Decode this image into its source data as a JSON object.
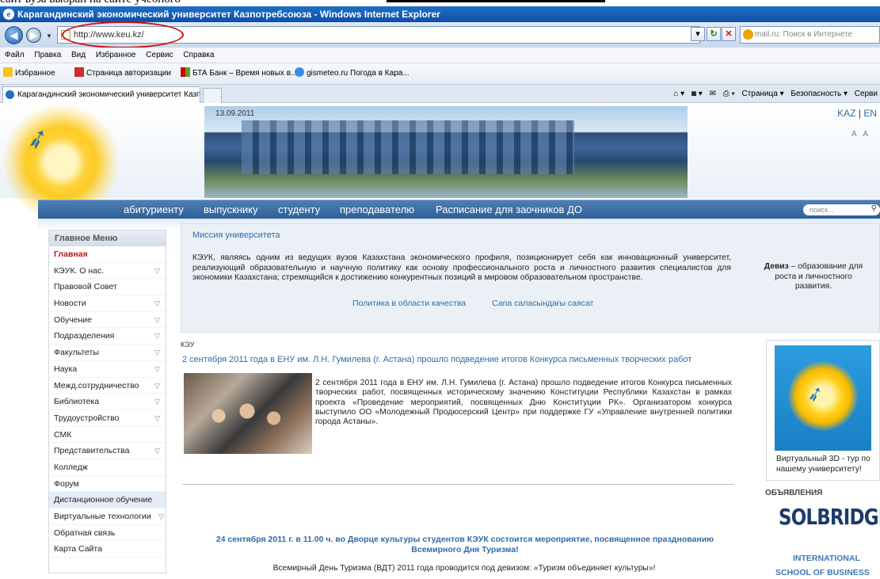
{
  "doc_caption": "сайт вуза выбран на сайте учебного",
  "window": {
    "title": "Карагандинский экономический университет Казпотребсоюза - Windows Internet Explorer"
  },
  "address_bar": {
    "url": "http://www.keu.kz/",
    "search_placeholder": "mail.ru: Поиск в Интернете"
  },
  "menubar": [
    "Файл",
    "Правка",
    "Вид",
    "Избранное",
    "Сервис",
    "Справка"
  ],
  "favorites_bar": {
    "favorites_label": "Избранное",
    "links": [
      "Страница авторизации",
      "БТА Банк – Время новых в...",
      "gismeteo.ru Погода в Кара..."
    ]
  },
  "tabs": {
    "active_title": "Карагандинский экономический университет Казп..."
  },
  "command_bar": [
    "Страница ▾",
    "Безопасность ▾",
    "Серви"
  ],
  "site": {
    "date": "13.09.2011",
    "lang_kaz": "KAZ",
    "lang_sep": "|",
    "lang_en": "EN",
    "font_ctrl": "A A",
    "nav": [
      "абитуриенту",
      "выпускнику",
      "студенту",
      "преподавателю",
      "Расписание для заочников ДО"
    ],
    "search_placeholder": "поиск...",
    "menu_title": "Главное Меню",
    "menu": [
      {
        "label": "Главная",
        "arrow": false,
        "active": true
      },
      {
        "label": "КЭУК. О нас.",
        "arrow": true
      },
      {
        "label": "Правовой Совет",
        "arrow": false
      },
      {
        "label": "Новости",
        "arrow": true
      },
      {
        "label": "Обучение",
        "arrow": true
      },
      {
        "label": "Подразделения",
        "arrow": true
      },
      {
        "label": "Факультеты",
        "arrow": true
      },
      {
        "label": "Наука",
        "arrow": true
      },
      {
        "label": "Межд.сотрудничество",
        "arrow": true
      },
      {
        "label": "Библиотека",
        "arrow": true
      },
      {
        "label": "Трудоустройство",
        "arrow": true
      },
      {
        "label": "СМК",
        "arrow": false
      },
      {
        "label": "Представительства",
        "arrow": true
      },
      {
        "label": "Колледж",
        "arrow": false
      },
      {
        "label": "Форум",
        "arrow": false
      },
      {
        "label": "Дистанционное обучение",
        "arrow": false,
        "highlight": true
      },
      {
        "label": "Виртуальные технологии",
        "arrow": true
      },
      {
        "label": "Обратная связь",
        "arrow": false
      },
      {
        "label": "Карта Сайта",
        "arrow": false
      }
    ],
    "mission": {
      "title": "Миссия университета",
      "text": "КЭУК, являясь одним из ведущих вузов Казахстана экономического профиля, позиционирует себя как инновационный университет, реализующий образовательную и научную политику как основу профессионального роста и личностного развития специалистов для экономики Казахстана; стремящийся к достижению конкурентных позиций в мировом образовательном пространстве.",
      "motto_bold": "Девиз",
      "motto_rest": " – образование для роста и личностного развития.",
      "link1": "Политика в области качества",
      "link2": "Сапа саласындағы саясат"
    },
    "news": {
      "category": "КЭУ",
      "title": "2 сентября 2011 года в ЕНУ им. Л.Н. Гумилева (г. Астана) прошло подведение итогов Конкурса письменных творческих работ",
      "text": "2 сентября 2011 года в ЕНУ им. Л.Н. Гумилева (г. Астана) прошло подведение итогов Конкурса письменных творческих работ, посвященных историческому значению Конституции Республики Казахстан в рамках проекта «Проведение мероприятий, посвященных Дню Конституции РК». Организатором конкурса выступило ОО «Молодежный Продюсерский Центр» при поддержке ГУ «Управление внутренней политики города Астаны».",
      "event_link": "24 сентября 2011 г. в 11.00 ч. во Дворце культуры студентов КЭУК состоится мероприятие, посвященное празднованию Всемирного Дня Туризма!",
      "event_text": "Всемирный День Туризма (ВДТ) 2011 года проводится под девизом:  «Туризм объединяет культуры»!"
    },
    "right": {
      "tour_text": "Виртуальный 3D - тур по нашему университету!",
      "ads_label": "ОБЪЯВЛЕНИЯ",
      "ad_logo": "SOLBRIDGE",
      "ad_line1": "INTERNATIONAL",
      "ad_line2": "SCHOOL OF BUSINESS"
    }
  }
}
